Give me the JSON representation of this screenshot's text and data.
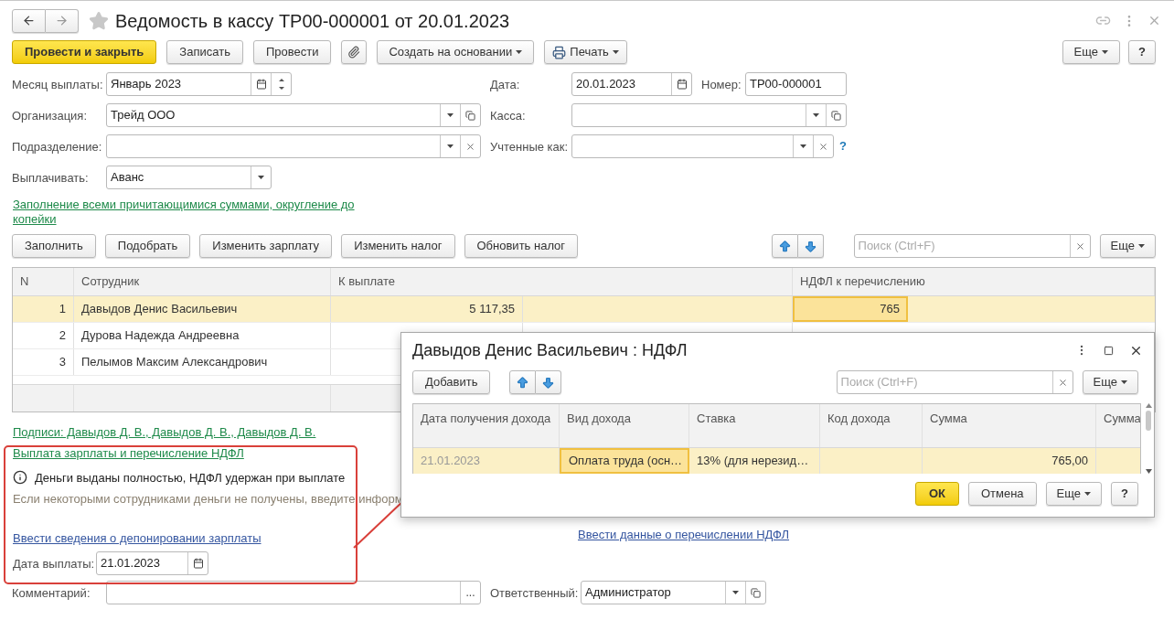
{
  "window": {
    "title": "Ведомость в кассу ТР00-000001 от 20.01.2023"
  },
  "toolbar": {
    "buttons": [
      {
        "label": "Провести и закрыть",
        "kind": "primary"
      },
      {
        "label": "Записать",
        "kind": "plain"
      },
      {
        "label": "Провести",
        "kind": "plain"
      },
      {
        "kind": "attach"
      },
      {
        "label": "Создать на основании",
        "kind": "menu"
      },
      {
        "label": "Печать",
        "kind": "print"
      }
    ],
    "more": "Еще",
    "help": "?"
  },
  "month": {
    "label": "Месяц выплаты:",
    "value": "Январь 2023"
  },
  "date": {
    "label": "Дата:",
    "value": "20.01.2023"
  },
  "number": {
    "label": "Номер:",
    "value": "ТР00-000001"
  },
  "organization": {
    "label": "Организация:",
    "value": "Трейд ООО"
  },
  "cash": {
    "label": "Касса:"
  },
  "department": {
    "label": "Подразделение:"
  },
  "accounted_as": {
    "label": "Учтенные как:",
    "help": "?"
  },
  "pay": {
    "label": "Выплачивать:",
    "value": "Аванс"
  },
  "fill_link": "Заполнение всеми причитающимися суммами, округление до копейки",
  "table_toolbar": {
    "buttons": [
      "Заполнить",
      "Подобрать",
      "Изменить зарплату",
      "Изменить налог",
      "Обновить налог"
    ],
    "search": {
      "placeholder": "Поиск (Ctrl+F)"
    },
    "more": "Еще"
  },
  "table": {
    "columns": [
      "N",
      "Сотрудник",
      "К выплате",
      "НДФЛ к перечислению"
    ],
    "rows": [
      {
        "selected": true,
        "n": "1",
        "employee": "Давыдов Денис Васильевич",
        "amount": "5 117,35",
        "tax": {
          "text": "765",
          "focused": true
        }
      },
      {
        "selected": false,
        "n": "2",
        "employee": "Дурова Надежда Андреевна"
      },
      {
        "selected": false,
        "n": "3",
        "employee": "Пелымов Максим Александрович"
      }
    ]
  },
  "signatures_link": "Подписи: Давыдов Д. В., Давыдов Д. В., Давыдов Д. В.",
  "payment": {
    "link": "Выплата зарплаты и перечисление НДФЛ",
    "info": "Деньги выданы полностью, НДФЛ удержан при выплате",
    "hint": "Если некоторыми сотрудниками деньги не получены, введите информ",
    "deposit_link": "Ввести сведения о депонировании зарплаты",
    "date_label": "Дата выплаты:",
    "date": "21.01.2023"
  },
  "tax_link": "Ввести данные о перечислении НДФЛ",
  "comment": {
    "label": "Комментарий:",
    "button": "..."
  },
  "responsible": {
    "label": "Ответственный:",
    "value": "Администратор"
  },
  "dialog": {
    "title": "Давыдов Денис Васильевич : НДФЛ",
    "add": "Добавить",
    "search": {
      "placeholder": "Поиск (Ctrl+F)"
    },
    "more": "Еще",
    "columns": [
      "Дата получения дохода",
      "Вид дохода",
      "Ставка",
      "Код дохода",
      "Сумма",
      "Сумма"
    ],
    "rows": [
      {
        "selected": true,
        "date": {
          "text": "21.01.2023",
          "focused": false
        },
        "type": {
          "text": "Оплата труда (осн…",
          "focused": true
        },
        "rate": {
          "text": "13% (для нерезид…",
          "focused": false
        },
        "sum": {
          "text": "765,00",
          "focused": false
        }
      }
    ],
    "ok": "ОК",
    "cancel": "Отмена",
    "footer_more": "Еще",
    "help": "?"
  }
}
